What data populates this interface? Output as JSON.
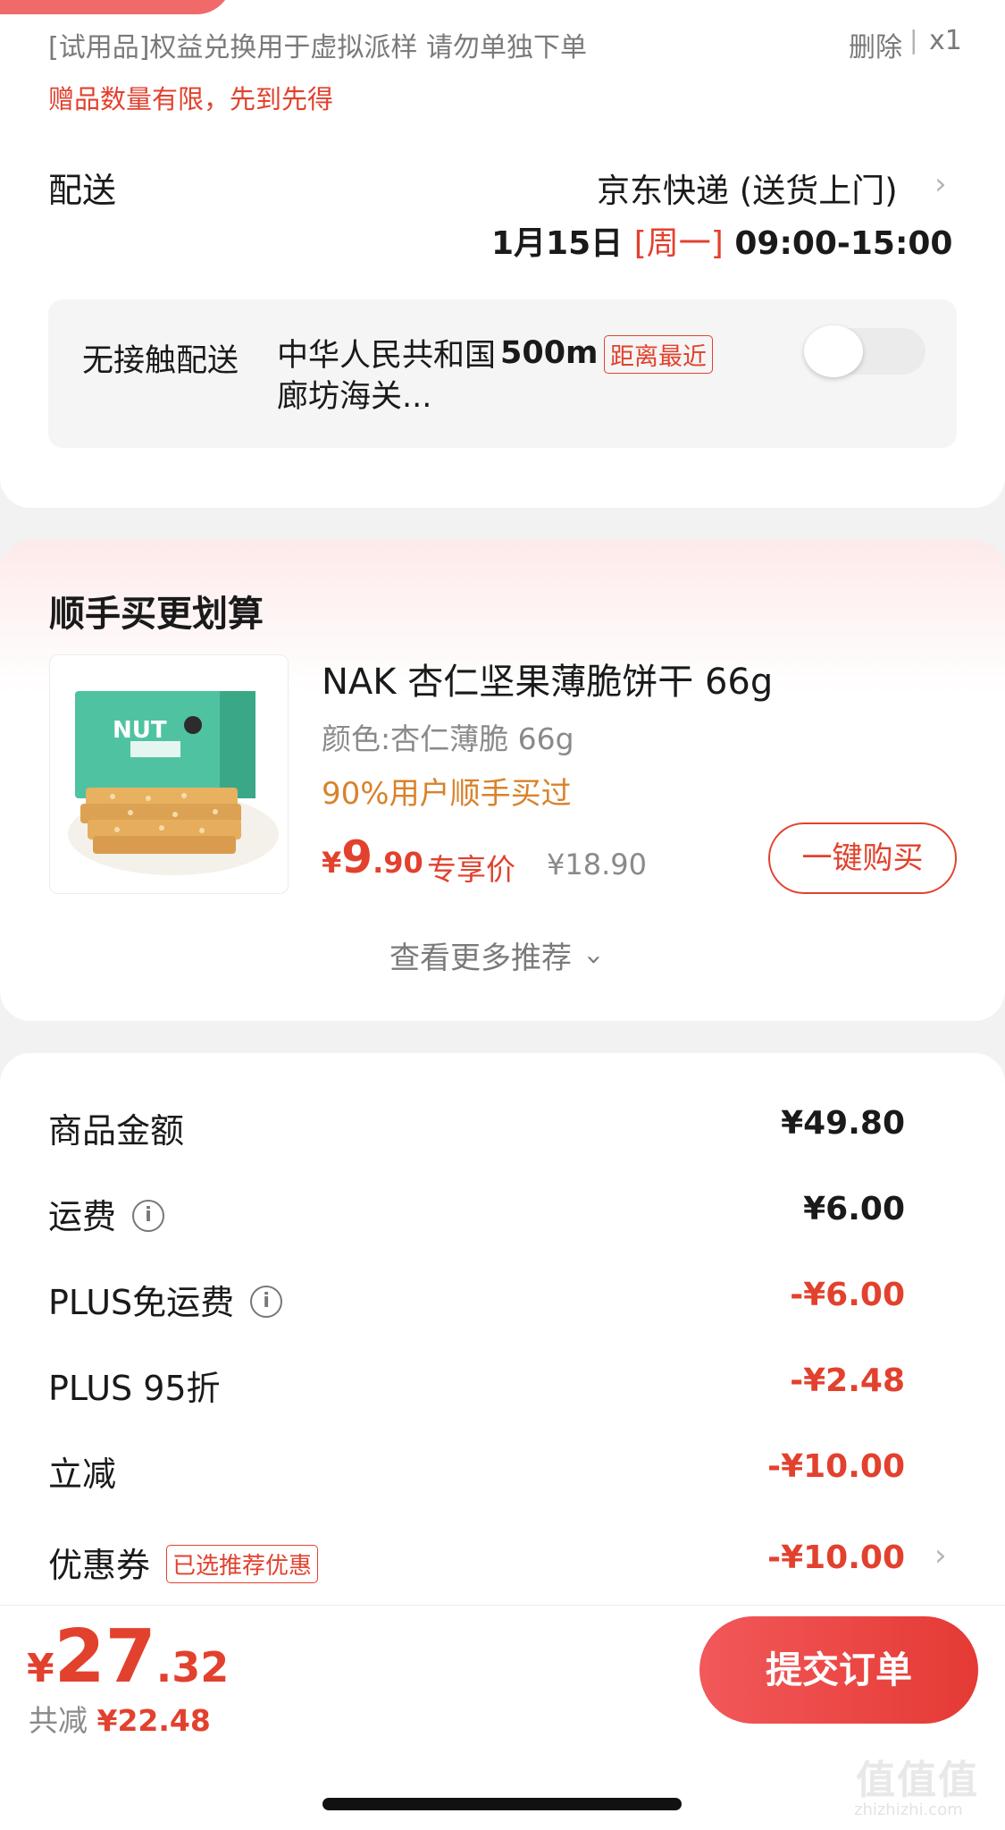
{
  "item": {
    "trial_text": "[试用品]权益兑换用于虚拟派样 请勿单独下单",
    "delete_label": "删除",
    "separator": "|",
    "quantity": "x1",
    "gift_note": "赠品数量有限，先到先得"
  },
  "delivery": {
    "label": "配送",
    "method": "京东快递 (送货上门)",
    "date": "1月15日",
    "weekday": "[周一]",
    "time_range": "09:00-15:00",
    "contactless": {
      "label": "无接触配送",
      "address": "中华人民共和国廊坊海关...",
      "distance": "500m",
      "nearest_badge": "距离最近",
      "enabled": false
    }
  },
  "recommend": {
    "title": "顺手买更划算",
    "product": {
      "name": "NAK 杏仁坚果薄脆饼干 66g",
      "variant": "颜色:杏仁薄脆 66g",
      "social_proof": "90%用户顺手买过",
      "price_symbol": "¥",
      "price_int": "9",
      "price_dec": ".90",
      "price_tag": "专享价",
      "original_price": "¥18.90",
      "buy_button": "一键购买"
    },
    "more_label": "查看更多推荐"
  },
  "summary": {
    "rows": [
      {
        "label": "商品金额",
        "amount": "¥49.80",
        "info": false
      },
      {
        "label": "运费",
        "amount": "¥6.00",
        "info": true
      },
      {
        "label": "PLUS免运费",
        "amount": "-¥6.00",
        "info": true
      },
      {
        "label": "PLUS 95折",
        "amount": "-¥2.48",
        "info": false
      },
      {
        "label": "立减",
        "amount": "-¥10.00",
        "info": false
      }
    ],
    "coupon": {
      "label": "优惠券",
      "badge": "已选推荐优惠",
      "amount": "-¥10.00"
    }
  },
  "checkout": {
    "total_symbol": "¥",
    "total_int": "27",
    "total_dec": ".32",
    "saved_label": "共减",
    "saved_amount": "¥22.48",
    "submit_label": "提交订单"
  },
  "watermark": {
    "logo": "值值值",
    "url": "zhizhizhi.com"
  },
  "colors": {
    "accent_red": "#e2412e",
    "social_orange": "#d9822b",
    "page_bg": "#f2f2f2"
  }
}
